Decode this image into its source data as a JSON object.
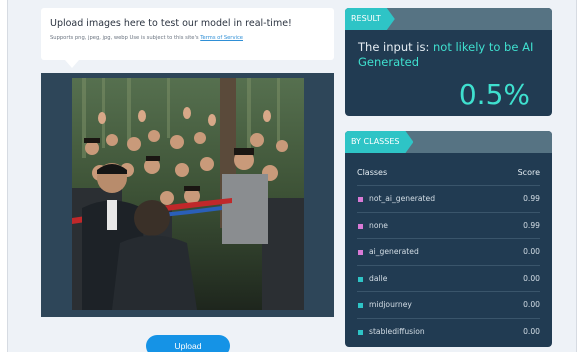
{
  "upload": {
    "title": "Upload images here to test our model in real-time!",
    "subtitle": "Supports png, jpeg, jpg, webp Use is subject to this site's ",
    "tos_link": "Terms of Service",
    "button_label": "Upload"
  },
  "image": {
    "description": "crowd-photo"
  },
  "result": {
    "tag": "RESULT",
    "prefix": "The input is: ",
    "verdict": "not likely to be AI Generated",
    "percent": "0.5%"
  },
  "classes": {
    "tag": "BY CLASSES",
    "col_class": "Classes",
    "col_score": "Score",
    "rows": [
      {
        "name": "not_ai_generated",
        "score": "0.99",
        "color": "#d97ad6"
      },
      {
        "name": "none",
        "score": "0.99",
        "color": "#d97ad6"
      },
      {
        "name": "ai_generated",
        "score": "0.00",
        "color": "#d97ad6"
      },
      {
        "name": "dalle",
        "score": "0.00",
        "color": "#2ec4c6"
      },
      {
        "name": "midjourney",
        "score": "0.00",
        "color": "#2ec4c6"
      },
      {
        "name": "stablediffusion",
        "score": "0.00",
        "color": "#2ec4c6"
      }
    ]
  },
  "colors": {
    "accent": "#3fe0cf",
    "tag": "#2ec4c6",
    "card": "#213b52",
    "button": "#1593e6"
  }
}
